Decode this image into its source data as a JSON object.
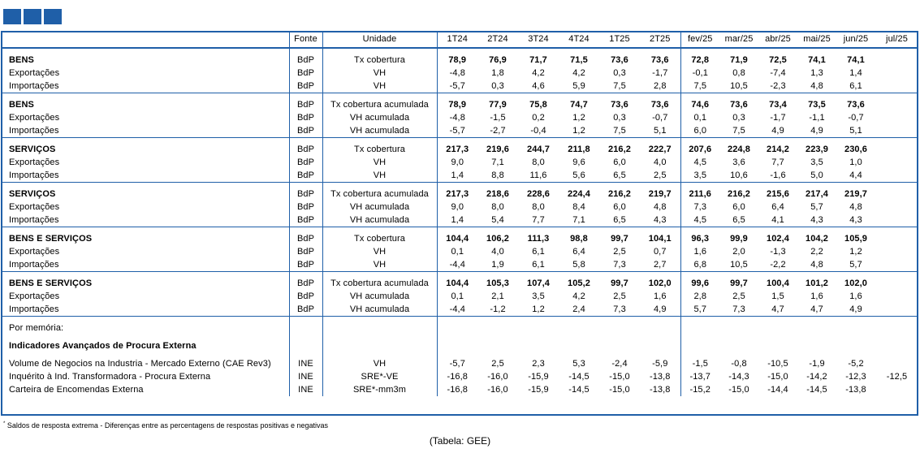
{
  "header": {
    "fonte": "Fonte",
    "unidade": "Unidade",
    "quarters": [
      "1T24",
      "2T24",
      "3T24",
      "4T24",
      "1T25",
      "2T25"
    ],
    "months": [
      "fev/25",
      "mar/25",
      "abr/25",
      "mai/25",
      "jun/25",
      "jul/25"
    ]
  },
  "blocks": [
    {
      "rows": [
        {
          "label": "BENS",
          "fonte": "BdP",
          "unit": "Tx cobertura",
          "q": [
            "78,9",
            "76,9",
            "71,7",
            "71,5",
            "73,6",
            "73,6"
          ],
          "m": [
            "72,8",
            "71,9",
            "72,5",
            "74,1",
            "74,1",
            ""
          ],
          "bold": true
        },
        {
          "label": "Exportações",
          "fonte": "BdP",
          "unit": "VH",
          "q": [
            "-4,8",
            "1,8",
            "4,2",
            "4,2",
            "0,3",
            "-1,7"
          ],
          "m": [
            "-0,1",
            "0,8",
            "-7,4",
            "1,3",
            "1,4",
            ""
          ]
        },
        {
          "label": "Importações",
          "fonte": "BdP",
          "unit": "VH",
          "q": [
            "-5,7",
            "0,3",
            "4,6",
            "5,9",
            "7,5",
            "2,8"
          ],
          "m": [
            "7,5",
            "10,5",
            "-2,3",
            "4,8",
            "6,1",
            ""
          ]
        }
      ]
    },
    {
      "rows": [
        {
          "label": "BENS",
          "fonte": "BdP",
          "unit": "Tx cobertura acumulada",
          "q": [
            "78,9",
            "77,9",
            "75,8",
            "74,7",
            "73,6",
            "73,6"
          ],
          "m": [
            "74,6",
            "73,6",
            "73,4",
            "73,5",
            "73,6",
            ""
          ],
          "bold": true
        },
        {
          "label": "Exportações",
          "fonte": "BdP",
          "unit": "VH acumulada",
          "q": [
            "-4,8",
            "-1,5",
            "0,2",
            "1,2",
            "0,3",
            "-0,7"
          ],
          "m": [
            "0,1",
            "0,3",
            "-1,7",
            "-1,1",
            "-0,7",
            ""
          ]
        },
        {
          "label": "Importações",
          "fonte": "BdP",
          "unit": "VH acumulada",
          "q": [
            "-5,7",
            "-2,7",
            "-0,4",
            "1,2",
            "7,5",
            "5,1"
          ],
          "m": [
            "6,0",
            "7,5",
            "4,9",
            "4,9",
            "5,1",
            ""
          ]
        }
      ]
    },
    {
      "rows": [
        {
          "label": "SERVIÇOS",
          "fonte": "BdP",
          "unit": "Tx cobertura",
          "q": [
            "217,3",
            "219,6",
            "244,7",
            "211,8",
            "216,2",
            "222,7"
          ],
          "m": [
            "207,6",
            "224,8",
            "214,2",
            "223,9",
            "230,6",
            ""
          ],
          "bold": true
        },
        {
          "label": "Exportações",
          "fonte": "BdP",
          "unit": "VH",
          "q": [
            "9,0",
            "7,1",
            "8,0",
            "9,6",
            "6,0",
            "4,0"
          ],
          "m": [
            "4,5",
            "3,6",
            "7,7",
            "3,5",
            "1,0",
            ""
          ]
        },
        {
          "label": "Importações",
          "fonte": "BdP",
          "unit": "VH",
          "q": [
            "1,4",
            "8,8",
            "11,6",
            "5,6",
            "6,5",
            "2,5"
          ],
          "m": [
            "3,5",
            "10,6",
            "-1,6",
            "5,0",
            "4,4",
            ""
          ]
        }
      ]
    },
    {
      "rows": [
        {
          "label": "SERVIÇOS",
          "fonte": "BdP",
          "unit": "Tx cobertura acumulada",
          "q": [
            "217,3",
            "218,6",
            "228,6",
            "224,4",
            "216,2",
            "219,7"
          ],
          "m": [
            "211,6",
            "216,2",
            "215,6",
            "217,4",
            "219,7",
            ""
          ],
          "bold": true
        },
        {
          "label": "Exportações",
          "fonte": "BdP",
          "unit": "VH acumulada",
          "q": [
            "9,0",
            "8,0",
            "8,0",
            "8,4",
            "6,0",
            "4,8"
          ],
          "m": [
            "7,3",
            "6,0",
            "6,4",
            "5,7",
            "4,8",
            ""
          ]
        },
        {
          "label": "Importações",
          "fonte": "BdP",
          "unit": "VH acumulada",
          "q": [
            "1,4",
            "5,4",
            "7,7",
            "7,1",
            "6,5",
            "4,3"
          ],
          "m": [
            "4,5",
            "6,5",
            "4,1",
            "4,3",
            "4,3",
            ""
          ]
        }
      ]
    },
    {
      "rows": [
        {
          "label": "BENS E SERVIÇOS",
          "fonte": "BdP",
          "unit": "Tx cobertura",
          "q": [
            "104,4",
            "106,2",
            "111,3",
            "98,8",
            "99,7",
            "104,1"
          ],
          "m": [
            "96,3",
            "99,9",
            "102,4",
            "104,2",
            "105,9",
            ""
          ],
          "bold": true
        },
        {
          "label": "Exportações",
          "fonte": "BdP",
          "unit": "VH",
          "q": [
            "0,1",
            "4,0",
            "6,1",
            "6,4",
            "2,5",
            "0,7"
          ],
          "m": [
            "1,6",
            "2,0",
            "-1,3",
            "2,2",
            "1,2",
            ""
          ]
        },
        {
          "label": "Importações",
          "fonte": "BdP",
          "unit": "VH",
          "q": [
            "-4,4",
            "1,9",
            "6,1",
            "5,8",
            "7,3",
            "2,7"
          ],
          "m": [
            "6,8",
            "10,5",
            "-2,2",
            "4,8",
            "5,7",
            ""
          ]
        }
      ]
    },
    {
      "rows": [
        {
          "label": "BENS E SERVIÇOS",
          "fonte": "BdP",
          "unit": "Tx cobertura acumulada",
          "q": [
            "104,4",
            "105,3",
            "107,4",
            "105,2",
            "99,7",
            "102,0"
          ],
          "m": [
            "99,6",
            "99,7",
            "100,4",
            "101,2",
            "102,0",
            ""
          ],
          "bold": true
        },
        {
          "label": "Exportações",
          "fonte": "BdP",
          "unit": "VH acumulada",
          "q": [
            "0,1",
            "2,1",
            "3,5",
            "4,2",
            "2,5",
            "1,6"
          ],
          "m": [
            "2,8",
            "2,5",
            "1,5",
            "1,6",
            "1,6",
            ""
          ]
        },
        {
          "label": "Importações",
          "fonte": "BdP",
          "unit": "VH acumulada",
          "q": [
            "-4,4",
            "-1,2",
            "1,2",
            "2,4",
            "7,3",
            "4,9"
          ],
          "m": [
            "5,7",
            "7,3",
            "4,7",
            "4,7",
            "4,9",
            ""
          ]
        }
      ]
    }
  ],
  "memo": {
    "title": "Por memória:",
    "subtitle": "Indicadores Avançados de Procura Externa",
    "rows": [
      {
        "label": "Volume de Negocios na Industria - Mercado Externo (CAE Rev3)",
        "fonte": "INE",
        "unit": "VH",
        "q": [
          "-5,7",
          "2,5",
          "2,3",
          "5,3",
          "-2,4",
          "-5,9"
        ],
        "m": [
          "-1,5",
          "-0,8",
          "-10,5",
          "-1,9",
          "-5,2",
          ""
        ]
      },
      {
        "label": "Inquérito à Ind. Transformadora - Procura Externa",
        "fonte": "INE",
        "unit": "SRE*-VE",
        "q": [
          "-16,8",
          "-16,0",
          "-15,9",
          "-14,5",
          "-15,0",
          "-13,8"
        ],
        "m": [
          "-13,7",
          "-14,3",
          "-15,0",
          "-14,2",
          "-12,3",
          "-12,5"
        ]
      },
      {
        "label": "Carteira de Encomendas Externa",
        "fonte": "INE",
        "unit": "SRE*-mm3m",
        "q": [
          "-16,8",
          "-16,0",
          "-15,9",
          "-14,5",
          "-15,0",
          "-13,8"
        ],
        "m": [
          "-15,2",
          "-15,0",
          "-14,4",
          "-14,5",
          "-13,8",
          ""
        ]
      }
    ]
  },
  "footnote": {
    "mark": "*",
    "text": " Saldos de resposta extrema - Diferenças entre as percentagens de respostas positivas e negativas"
  },
  "source": "(Tabela: GEE)",
  "colors": {
    "accent": "#1f5fa8"
  }
}
